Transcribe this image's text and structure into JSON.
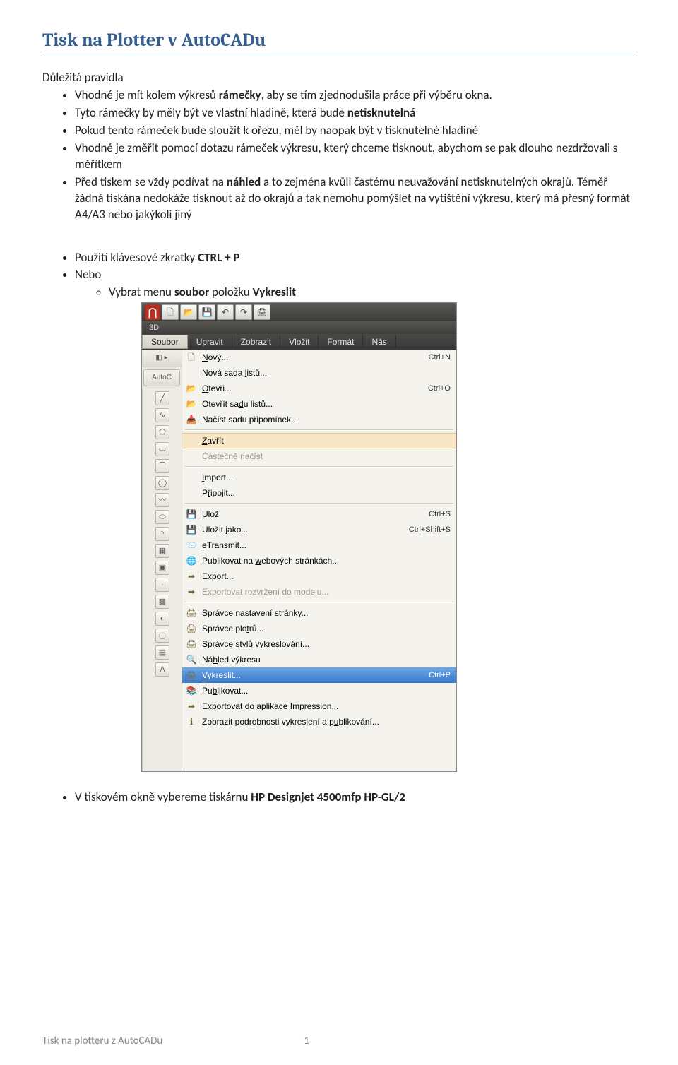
{
  "title": "Tisk na Plotter v AutoCADu",
  "section1_heading": "Důležitá pravidla",
  "bullets1": [
    {
      "pre": "Vhodné je mít kolem výkresů ",
      "b": "rámečky",
      "post": ", aby se tím zjednodušila práce při výběru okna."
    },
    {
      "pre": "Tyto rámečky by měly být ve vlastní hladině, která bude ",
      "b": "netisknutelná",
      "post": ""
    },
    {
      "pre": "Pokud tento rámeček bude sloužit k ořezu, měl by naopak být v tisknutelné hladině",
      "b": "",
      "post": ""
    },
    {
      "pre": "Vhodné je změřit pomocí dotazu rámeček výkresu, který chceme tisknout, abychom se pak dlouho nezdržovali s měřítkem",
      "b": "",
      "post": ""
    },
    {
      "pre": "Před tiskem se vždy podívat na ",
      "b": "náhled",
      "post": " a to zejména kvůli častému neuvažování netisknutelných okrajů. Téměř žádná tiskána nedokáže tisknout až do okrajů a tak nemohu pomýšlet na vytištění výkresu, který má přesný formát A4/A3 nebo jakýkoli jiný"
    }
  ],
  "bullets2": {
    "b2_0_pre": "Použití klávesové zkratky ",
    "b2_0_b": "CTRL + P",
    "b2_1": "Nebo",
    "b2_1_sub_pre": "Vybrat menu ",
    "b2_1_sub_b1": "soubor",
    "b2_1_sub_mid": " položku ",
    "b2_1_sub_b2": "Vykreslit",
    "b2_last_pre": "V tiskovém okně vybereme tiskárnu ",
    "b2_last_b": "HP Designjet 4500mfp HP-GL/2"
  },
  "shot": {
    "ribbon3d": "3D",
    "menubar": [
      "Soubor",
      "Upravit",
      "Zobrazit",
      "Vložit",
      "Formát",
      "Nás"
    ],
    "autoc_label": "AutoC",
    "items": [
      {
        "icon": "🗋",
        "label_u": "N",
        "label_rest": "ový...",
        "shortcut": "Ctrl+N",
        "arrow": false
      },
      {
        "icon": "",
        "label_u": "",
        "label_rest": "Nová sada ",
        "label_u2": "l",
        "label_rest2": "istů...",
        "shortcut": "",
        "arrow": false
      },
      {
        "icon": "📂",
        "label_u": "O",
        "label_rest": "tevři...",
        "shortcut": "Ctrl+O",
        "arrow": false
      },
      {
        "icon": "📂",
        "label_u": "",
        "label_rest": "Otevřít sa",
        "label_u2": "d",
        "label_rest2": "u listů...",
        "shortcut": "",
        "arrow": false
      },
      {
        "icon": "📥",
        "label_u": "",
        "label_rest": "Načíst sadu připomínek...",
        "shortcut": "",
        "arrow": false
      },
      {
        "sep": true
      },
      {
        "icon": "",
        "label_u": "Z",
        "label_rest": "avřít",
        "shortcut": "",
        "arrow": false,
        "hover": true
      },
      {
        "icon": "",
        "label_u": "",
        "label_rest": "Částečně načíst",
        "shortcut": "",
        "arrow": false,
        "disabled": true
      },
      {
        "sep": true
      },
      {
        "icon": "",
        "label_u": "I",
        "label_rest": "mport...",
        "shortcut": "",
        "arrow": false
      },
      {
        "icon": "",
        "label_u": "",
        "label_rest": "P",
        "label_u2": "ř",
        "label_rest2": "ipojit...",
        "shortcut": "",
        "arrow": false
      },
      {
        "sep": true
      },
      {
        "icon": "💾",
        "label_u": "U",
        "label_rest": "lož",
        "shortcut": "Ctrl+S",
        "arrow": false
      },
      {
        "icon": "💾",
        "label_u": "",
        "label_rest": "Uložit ",
        "label_u2": "j",
        "label_rest2": "ako...",
        "shortcut": "Ctrl+Shift+S",
        "arrow": false
      },
      {
        "icon": "📨",
        "label_u": "e",
        "label_rest": "Transmit...",
        "shortcut": "",
        "arrow": false
      },
      {
        "icon": "🌐",
        "label_u": "",
        "label_rest": "Publikovat na ",
        "label_u2": "w",
        "label_rest2": "ebových stránkách...",
        "shortcut": "",
        "arrow": false
      },
      {
        "icon": "➡",
        "label_u": "",
        "label_rest": "Export...",
        "shortcut": "",
        "arrow": false
      },
      {
        "icon": "➡",
        "label_u": "",
        "label_rest": "Exportovat rozvržení do modelu...",
        "shortcut": "",
        "arrow": false,
        "disabled": true
      },
      {
        "sep": true
      },
      {
        "icon": "🖨",
        "label_u": "",
        "label_rest": "Správce nastavení stránk",
        "label_u2": "y",
        "label_rest2": "...",
        "shortcut": "",
        "arrow": false
      },
      {
        "icon": "🖨",
        "label_u": "",
        "label_rest": "Správce plo",
        "label_u2": "t",
        "label_rest2": "rů...",
        "shortcut": "",
        "arrow": false
      },
      {
        "icon": "🖨",
        "label_u": "",
        "label_rest": "Správce stylů vykreslování...",
        "shortcut": "",
        "arrow": false
      },
      {
        "icon": "🔍",
        "label_u": "",
        "label_rest": "Ná",
        "label_u2": "h",
        "label_rest2": "led výkresu",
        "shortcut": "",
        "arrow": false
      },
      {
        "icon": "🖨",
        "label_u": "V",
        "label_rest": "ykreslit...",
        "shortcut": "Ctrl+P",
        "arrow": false,
        "selected": true
      },
      {
        "icon": "📚",
        "label_u": "",
        "label_rest": "Pu",
        "label_u2": "b",
        "label_rest2": "likovat...",
        "shortcut": "",
        "arrow": false
      },
      {
        "icon": "➡",
        "label_u": "",
        "label_rest": "Exportovat do aplikace ",
        "label_u2": "I",
        "label_rest2": "mpression...",
        "shortcut": "",
        "arrow": false
      },
      {
        "icon": "ℹ",
        "label_u": "",
        "label_rest": "Zobrazit podrobnosti vykreslení a p",
        "label_u2": "u",
        "label_rest2": "blikování...",
        "shortcut": "",
        "arrow": false
      }
    ]
  },
  "footer_title": "Tisk na plotteru z AutoCADu",
  "footer_page": "1"
}
